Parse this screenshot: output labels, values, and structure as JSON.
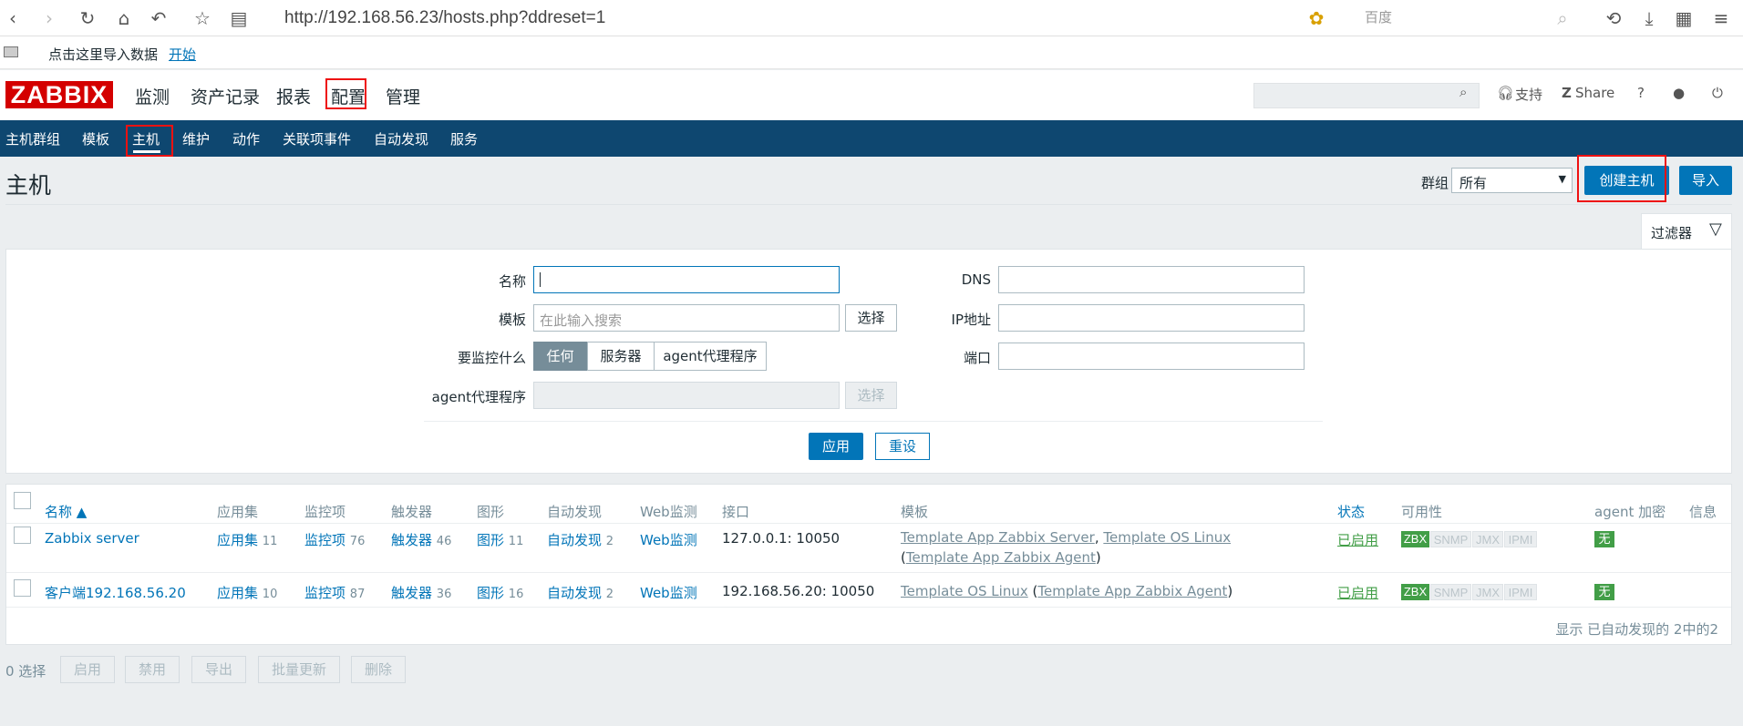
{
  "browser": {
    "url": "http://192.168.56.23/hosts.php?ddreset=1",
    "search_placeholder": "百度"
  },
  "favbar": {
    "text": "点击这里导入数据",
    "link": "开始"
  },
  "topmenu": {
    "logo": "ZABBIX",
    "items": [
      "监测",
      "资产记录",
      "报表",
      "配置",
      "管理"
    ],
    "support": "支持",
    "share": "Share",
    "help": "?"
  },
  "subnav": {
    "items": [
      "主机群组",
      "模板",
      "主机",
      "维护",
      "动作",
      "关联项事件",
      "自动发现",
      "服务"
    ]
  },
  "header": {
    "title": "主机",
    "group_label": "群组",
    "group_value": "所有",
    "create_button": "创建主机",
    "import_button": "导入"
  },
  "filter": {
    "tab_label": "过滤器",
    "name_label": "名称",
    "template_label": "模板",
    "template_placeholder": "在此输入搜索",
    "select_button": "选择",
    "monitor_label": "要监控什么",
    "monitor_options": [
      "任何",
      "服务器",
      "agent代理程序"
    ],
    "proxy_label": "agent代理程序",
    "proxy_select": "选择",
    "dns_label": "DNS",
    "ip_label": "IP地址",
    "port_label": "端口",
    "apply": "应用",
    "reset": "重设"
  },
  "table": {
    "headers": [
      "名称 ▲",
      "应用集",
      "监控项",
      "触发器",
      "图形",
      "自动发现",
      "Web监测",
      "接口",
      "模板",
      "状态",
      "可用性",
      "agent 加密",
      "信息"
    ],
    "rows": [
      {
        "name": "Zabbix server",
        "apps_label": "应用集",
        "apps": "11",
        "items_label": "监控项",
        "items": "76",
        "triggers_label": "触发器",
        "triggers": "46",
        "graphs_label": "图形",
        "graphs": "11",
        "discovery_label": "自动发现",
        "discovery": "2",
        "web": "Web监测",
        "interface": "127.0.0.1: 10050",
        "tpl1": "Template App Zabbix Server",
        "tpl2": "Template OS Linux",
        "tpl3": "Template App Zabbix Agent",
        "status": "已启用",
        "avail": [
          "ZBX",
          "SNMP",
          "JMX",
          "IPMI"
        ],
        "encryption": "无"
      },
      {
        "name": "客户端192.168.56.20",
        "apps_label": "应用集",
        "apps": "10",
        "items_label": "监控项",
        "items": "87",
        "triggers_label": "触发器",
        "triggers": "36",
        "graphs_label": "图形",
        "graphs": "16",
        "discovery_label": "自动发现",
        "discovery": "2",
        "web": "Web监测",
        "interface": "192.168.56.20: 10050",
        "tpl1": "Template OS Linux",
        "tpl2": "Template App Zabbix Agent",
        "status": "已启用",
        "avail": [
          "ZBX",
          "SNMP",
          "JMX",
          "IPMI"
        ],
        "encryption": "无"
      }
    ],
    "footer": "显示 已自动发现的 2中的2"
  },
  "actions": {
    "selected": "0 选择",
    "buttons": [
      "启用",
      "禁用",
      "导出",
      "批量更新",
      "删除"
    ]
  },
  "colors": {
    "accent": "#0275b8",
    "nav": "#0e4770",
    "logo": "#d40000",
    "green": "#429e47",
    "highlight": "#e11111"
  }
}
